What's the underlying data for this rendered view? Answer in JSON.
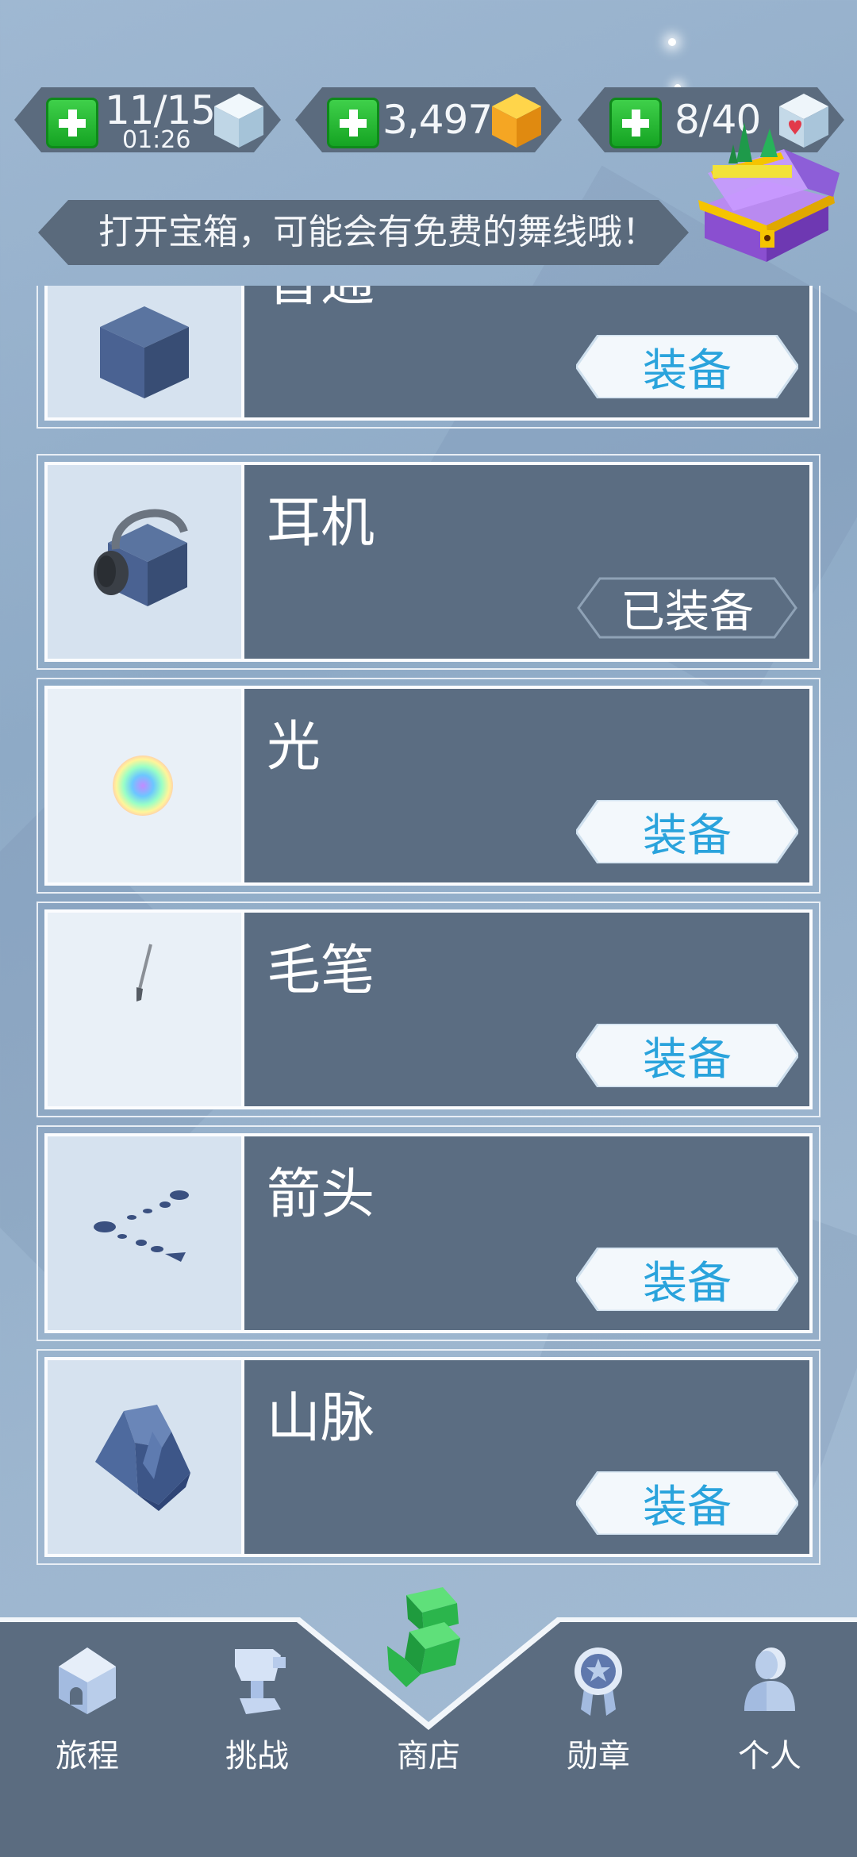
{
  "resources": {
    "energy": {
      "value": "11/15",
      "timer": "01:26",
      "icon": "ice-cube-icon"
    },
    "gems": {
      "value": "3,497",
      "icon": "gold-gem-icon"
    },
    "hearts": {
      "value": "8/40",
      "icon": "heart-cube-icon"
    }
  },
  "banner": {
    "text": "打开宝箱，可能会有免费的舞线哦！"
  },
  "items": [
    {
      "name": "普通",
      "button": "装备",
      "equipped": false,
      "icon": "blue-cube-icon"
    },
    {
      "name": "耳机",
      "button": "已装备",
      "equipped": true,
      "icon": "headphones-cube-icon"
    },
    {
      "name": "光",
      "button": "装备",
      "equipped": false,
      "icon": "rainbow-light-icon"
    },
    {
      "name": "毛笔",
      "button": "装备",
      "equipped": false,
      "icon": "brush-icon"
    },
    {
      "name": "箭头",
      "button": "装备",
      "equipped": false,
      "icon": "arrow-dots-icon"
    },
    {
      "name": "山脉",
      "button": "装备",
      "equipped": false,
      "icon": "mountain-icon"
    }
  ],
  "nav": [
    {
      "label": "旅程",
      "icon": "house-icon"
    },
    {
      "label": "挑战",
      "icon": "trophy-icon"
    },
    {
      "label": "商店",
      "icon": "shop-s-icon"
    },
    {
      "label": "勋章",
      "icon": "medal-icon"
    },
    {
      "label": "个人",
      "icon": "person-icon"
    }
  ],
  "colors": {
    "accent": "#2aa3dc",
    "card": "#5b6d82",
    "background": "#9fb8d2",
    "nav": "#5b6c80"
  }
}
